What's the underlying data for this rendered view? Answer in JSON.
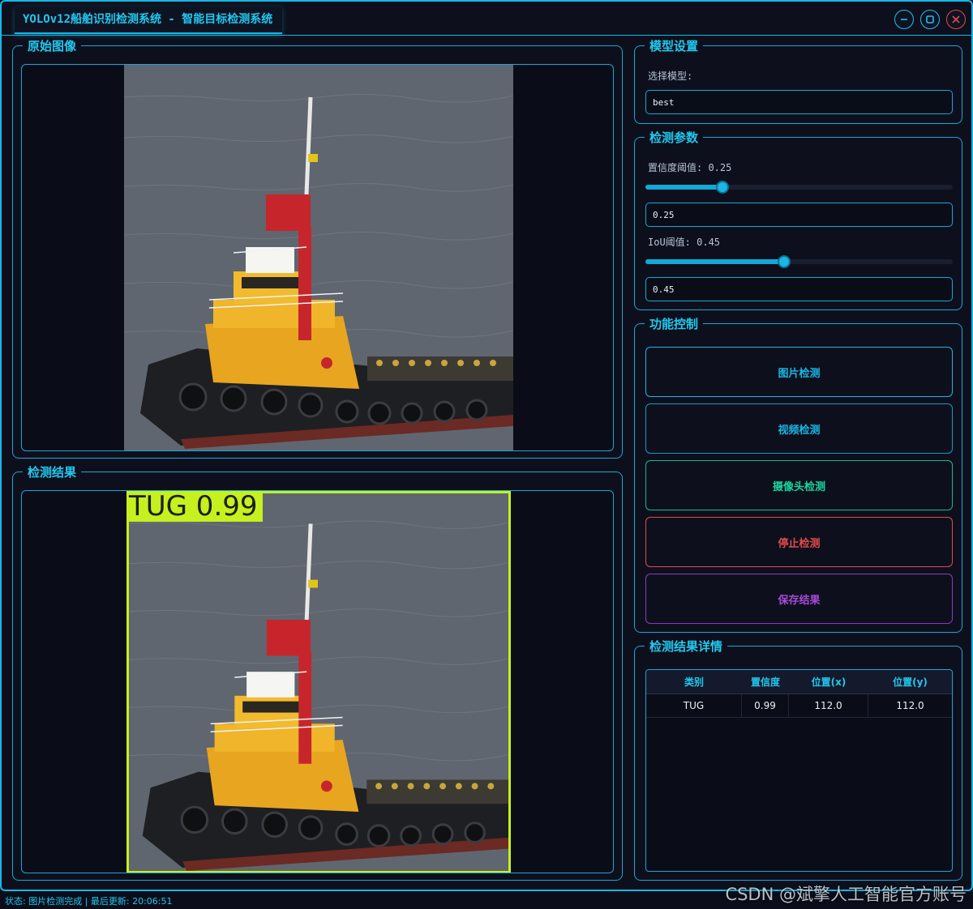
{
  "window": {
    "title": "YOLOv12船舶识别检测系统 - 智能目标检测系统",
    "controls": {
      "minimize": "minimize-icon",
      "maximize": "maximize-icon",
      "close": "close-icon"
    }
  },
  "original_panel": {
    "title": "原始图像"
  },
  "result_panel": {
    "title": "检测结果",
    "detection_label": "TUG 0.99",
    "box_color": "#c6f01e"
  },
  "model_settings": {
    "title": "模型设置",
    "select_label": "选择模型:",
    "selected_model": "best"
  },
  "detect_params": {
    "title": "检测参数",
    "conf_label": "置信度阈值: 0.25",
    "conf_value": 0.25,
    "conf_input": "0.25",
    "iou_label": "IoU阈值: 0.45",
    "iou_value": 0.45,
    "iou_input": "0.45"
  },
  "controls": {
    "title": "功能控制",
    "image_detect": "图片检测",
    "video_detect": "视频检测",
    "camera_detect": "摄像头检测",
    "stop_detect": "停止检测",
    "save_result": "保存结果",
    "colors": {
      "image": "#1ab6e6",
      "video": "#1ab6e6",
      "camera": "#1ad6a0",
      "stop": "#e14b4b",
      "save": "#a64ad6"
    }
  },
  "details": {
    "title": "检测结果详情",
    "headers": [
      "类别",
      "置信度",
      "位置(x)",
      "位置(y)"
    ],
    "rows": [
      [
        "TUG",
        "0.99",
        "112.0",
        "112.0"
      ]
    ]
  },
  "status": {
    "text": "状态: 图片检测完成 | 最后更新: 20:06:51"
  },
  "watermark": "CSDN @斌擎人工智能官方账号"
}
